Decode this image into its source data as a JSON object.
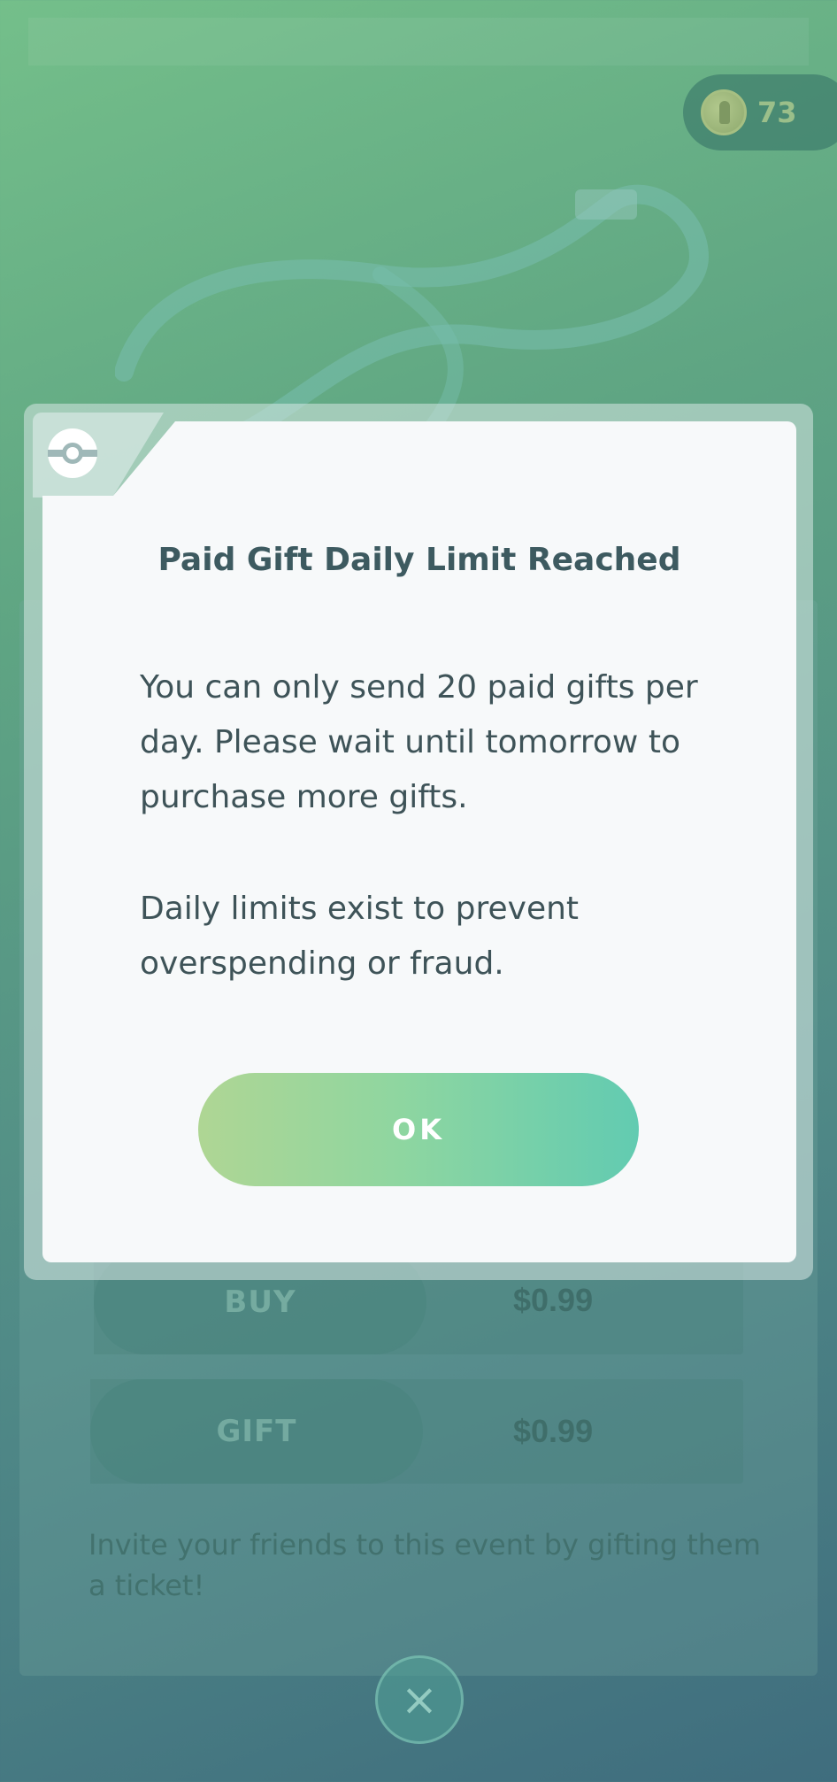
{
  "header": {
    "coin_count": "73"
  },
  "background": {
    "buy_label": "BUY",
    "buy_price": "$0.99",
    "gift_label": "GIFT",
    "gift_price": "$0.99",
    "invite_text": "Invite your friends to this event by gifting them a ticket!"
  },
  "dialog": {
    "title": "Paid Gift Daily Limit Reached",
    "paragraph1": "You can only send 20 paid gifts per day. Please wait until tomorrow to purchase more gifts.",
    "paragraph2": "Daily limits exist to prevent overspending or fraud.",
    "ok_label": "OK"
  },
  "colors": {
    "accent_start": "#afd694",
    "accent_end": "#62cbb1",
    "text_dark": "#3d5a60"
  },
  "icons": {
    "coin": "coin-icon",
    "pokeball": "pokeball-icon",
    "close": "close-icon",
    "strap": "ticket-strap-image"
  }
}
